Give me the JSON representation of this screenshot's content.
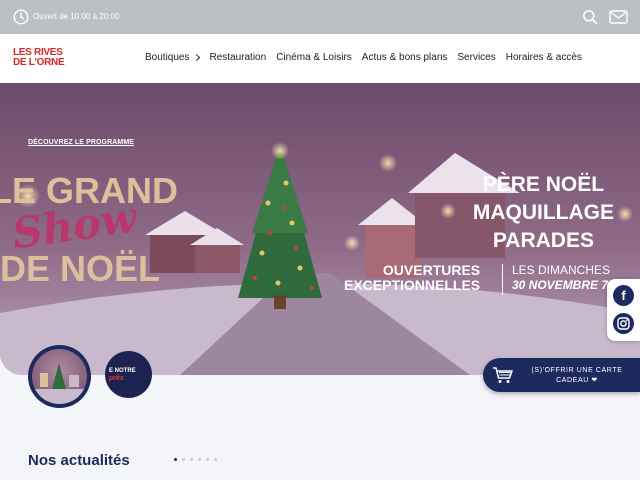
{
  "topbar": {
    "hours": "Ouvert de 10:00 à 20:00",
    "icons": [
      "clock-icon",
      "search-icon",
      "mail-icon"
    ]
  },
  "logo": {
    "line1": "LES RIVES",
    "line2": "DE L'ORNE",
    "color": "#d6262a"
  },
  "nav": [
    {
      "label": "Boutiques",
      "has_chevron": true
    },
    {
      "label": "Restauration"
    },
    {
      "label": "Cinéma & Loisirs"
    },
    {
      "label": "Actus & bons plans"
    },
    {
      "label": "Services"
    },
    {
      "label": "Horaires & accès"
    }
  ],
  "hero": {
    "discover_link": "DÉCOUVREZ LE PROGRAMME",
    "title_line1": "LE GRAND",
    "title_script": "Show",
    "title_line2": "DE NOËL",
    "right_lines": [
      "PÈRE NOËL",
      "MAQUILLAGE",
      "PARADES"
    ],
    "open_line1": "OUVERTURES",
    "open_line2": "EXCEPTIONNELLES",
    "days_line1": "LES DIMANCHES",
    "days_line2": "30 NOVEMBRE 7,"
  },
  "social": {
    "facebook": "f"
  },
  "thumbnails": {
    "second_text_1": "E NOTRE",
    "second_text_2": "prés"
  },
  "giftcard": {
    "line1": "(S)'OFFRIR UNE CARTE",
    "line2": "CADEAU ❤"
  },
  "news": {
    "title": "Nos actualités",
    "dot_count": 6,
    "active_dot": 0
  },
  "colors": {
    "navy": "#1d2a5e",
    "topbar": "#bcbfc4",
    "gold": "#d9c19b",
    "pink": "#b8386e"
  }
}
